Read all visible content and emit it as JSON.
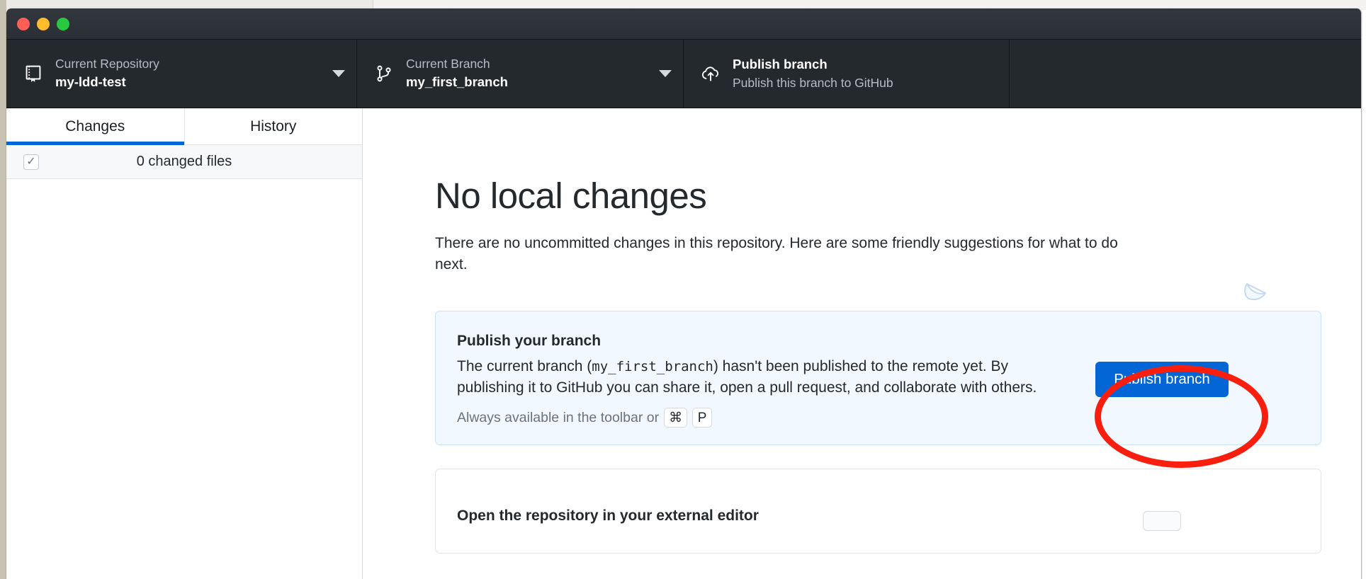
{
  "window": {
    "traffic_lights": [
      "close",
      "minimize",
      "zoom"
    ],
    "colors": {
      "titlebar": "#2b2f36",
      "toolbar": "#24292e",
      "accent_blue": "#0366d6",
      "card_blue_bg": "#f1f8ff",
      "card_blue_border": "#c8e1ff",
      "annotation_red": "#fa1e0e"
    }
  },
  "toolbar": {
    "repository": {
      "icon": "repo-book-icon",
      "label": "Current Repository",
      "value": "my-ldd-test",
      "caret": "chevron-down-icon"
    },
    "branch": {
      "icon": "git-branch-icon",
      "label": "Current Branch",
      "value": "my_first_branch",
      "caret": "chevron-down-icon"
    },
    "publish": {
      "icon": "cloud-upload-icon",
      "label": "Publish branch",
      "value": "Publish this branch to GitHub"
    }
  },
  "sidebar": {
    "tabs": [
      {
        "label": "Changes",
        "active": true
      },
      {
        "label": "History",
        "active": false
      }
    ],
    "changed_files": {
      "checkbox_checked": true,
      "checkbox_glyph": "✓",
      "label": "0 changed files"
    },
    "file_list": []
  },
  "main": {
    "title": "No local changes",
    "subtitle": "There are no uncommitted changes in this repository. Here are some friendly suggestions for what to do next.",
    "illustration": "paper-stack-illustration",
    "cards": [
      {
        "title": "Publish your branch",
        "body_prefix": "The current branch (",
        "body_code": "my_first_branch",
        "body_suffix": ") hasn't been published to the remote yet. By publishing it to GitHub you can share it, open a pull request, and collaborate with others.",
        "footnote": "Always available in the toolbar or",
        "keycaps": [
          "⌘",
          "P"
        ],
        "button": "Publish branch"
      },
      {
        "title": "Open the repository in your external editor",
        "button": ""
      }
    ]
  },
  "annotation": {
    "shape": "ellipse",
    "target": "Publish branch",
    "color": "#fa1e0e"
  }
}
